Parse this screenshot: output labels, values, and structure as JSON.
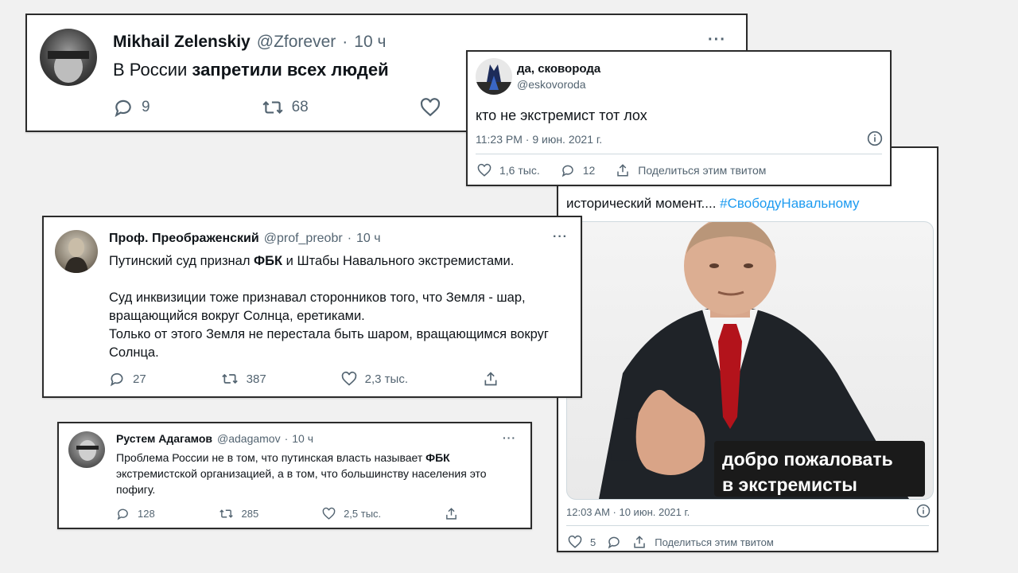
{
  "tweet1": {
    "name": "Mikhail Zelenskiy",
    "handle": "@Zforever",
    "time": "10 ч",
    "text_plain": "В России ",
    "text_bold": "запретили всех людей",
    "replies": "9",
    "retweets": "68"
  },
  "tweet2": {
    "name": "да, сковорода",
    "handle": "@eskovoroda",
    "text": "кто не экстремист тот лох",
    "timestamp": "11:23 PM · 9 июн. 2021 г.",
    "likes": "1,6 тыс.",
    "replies": "12",
    "share_label": "Поделиться этим твитом"
  },
  "tweet3": {
    "text": "исторический момент....",
    "hashtag": "#СвободуНавальному",
    "image_caption_line1": "добро пожаловать",
    "image_caption_line2": "в экстремисты",
    "timestamp": "12:03 AM · 10 июн. 2021 г.",
    "likes": "5",
    "share_label": "Поделиться этим твитом"
  },
  "tweet4": {
    "name": "Проф. Преображенский",
    "handle": "@prof_preobr",
    "time": "10 ч",
    "line1_a": "Путинский суд признал ",
    "line1_bold": "ФБК",
    "line1_b": " и Штабы Навального экстремистами.",
    "para2": "Суд инквизиции тоже признавал сторонников того, что Земля - шар, вращающийся вокруг Солнца, еретиками.",
    "para3": "Только от этого Земля не перестала быть шаром, вращающимся вокруг Солнца.",
    "replies": "27",
    "retweets": "387",
    "likes": "2,3 тыс."
  },
  "tweet5": {
    "name": "Рустем Адагамов",
    "handle": "@adagamov",
    "time": "10 ч",
    "text_a": "Проблема России не в том, что путинская власть называет ",
    "text_bold": "ФБК",
    "text_b": " экстремистской организацией, а в том, что большинству населения это пофигу.",
    "replies": "128",
    "retweets": "285",
    "likes": "2,5 тыс."
  },
  "icons": [
    "reply-icon",
    "retweet-icon",
    "like-icon",
    "share-icon",
    "info-icon",
    "more-icon"
  ]
}
